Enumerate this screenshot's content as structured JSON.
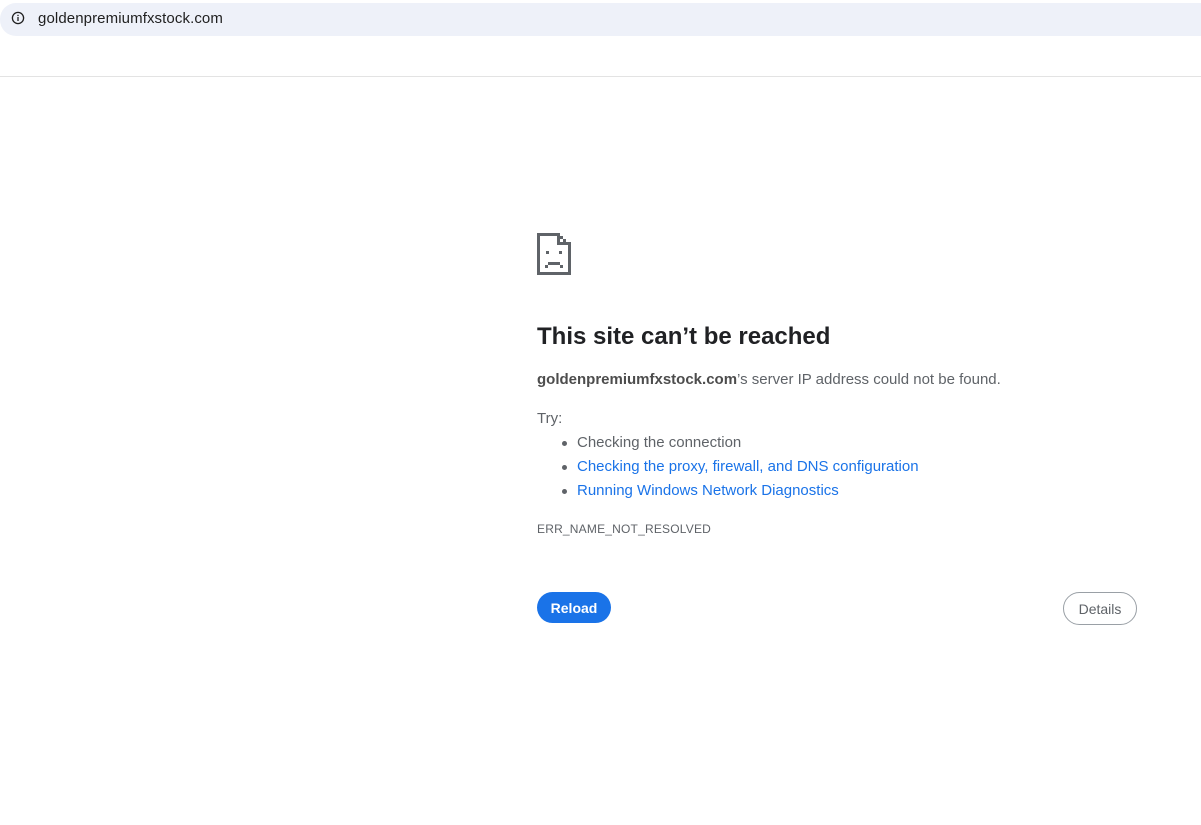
{
  "address_bar": {
    "url": "goldenpremiumfxstock.com",
    "icon": "info-icon"
  },
  "error": {
    "icon": "sad-page-icon",
    "title": "This site can’t be reached",
    "domain": "goldenpremiumfxstock.com",
    "summary_suffix": "’s server IP address could not be found.",
    "try_label": "Try:",
    "suggestions": [
      {
        "label": "Checking the connection",
        "is_link": false
      },
      {
        "label": "Checking the proxy, firewall, and DNS configuration",
        "is_link": true
      },
      {
        "label": "Running Windows Network Diagnostics",
        "is_link": true
      }
    ],
    "code": "ERR_NAME_NOT_RESOLVED"
  },
  "buttons": {
    "reload_label": "Reload",
    "details_label": "Details"
  },
  "colors": {
    "accent": "#1a73e8",
    "address_bar_bg": "#eef1f9",
    "text_secondary": "#5f6368",
    "heading": "#202124"
  }
}
